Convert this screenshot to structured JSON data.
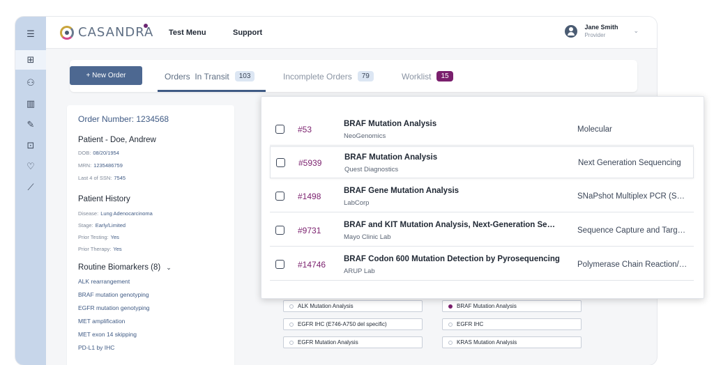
{
  "app": {
    "brand": "CASANDRA"
  },
  "topbar": {
    "nav": [
      "Test Menu",
      "Support"
    ],
    "user_name": "Jane Smith",
    "user_role": "Provider"
  },
  "toolbar": {
    "new_order_label": "+ New Order"
  },
  "tabs": [
    {
      "label": "Orders  In Transit",
      "count": "103"
    },
    {
      "label": "Incomplete Orders",
      "count": "79"
    },
    {
      "label": "Worklist",
      "count": "15"
    }
  ],
  "order": {
    "number": "Order Number: 1234568",
    "patient_title": "Patient - Doe, Andrew",
    "dob_label": "DOB:",
    "dob": "08/20/1954",
    "mrn_label": "MRN:",
    "mrn": "1235486759",
    "ssn_label": "Last 4 of SSN:",
    "ssn": "7545",
    "history_title": "Patient History",
    "disease_label": "Disease:",
    "disease": "Lung Adenocarcinoma",
    "stage_label": "Stage:",
    "stage": "Early/Limited",
    "prior_testing_label": "Prior Testing:",
    "prior_testing": "Yes",
    "prior_therapy_label": "Prior Therapy:",
    "prior_therapy": "Yes",
    "biomarkers_title": "Routine Biomarkers (8)",
    "biomarkers": [
      "ALK rearrangement",
      "BRAF mutation genotyping",
      "EGFR mutation genotyping",
      "MET amplification",
      "MET exon 14 skipping",
      "PD-L1 by IHC"
    ]
  },
  "options": [
    {
      "label": "ALK Mutation Analysis",
      "selected": false
    },
    {
      "label": "BRAF Mutation Analysis",
      "selected": true
    },
    {
      "label": "EGFR IHC (E746-A750 del specific)",
      "selected": false
    },
    {
      "label": "EGFR IHC",
      "selected": false
    },
    {
      "label": "EGFR Mutation Analysis",
      "selected": false
    },
    {
      "label": "KRAS Mutation Analysis",
      "selected": false
    }
  ],
  "results": [
    {
      "id": "#53",
      "title": "BRAF Mutation Analysis",
      "lab": "NeoGenomics",
      "method": "Molecular"
    },
    {
      "id": "#5939",
      "title": "BRAF Mutation Analysis",
      "lab": "Quest Diagnostics",
      "method": "Next Generation Sequencing"
    },
    {
      "id": "#1498",
      "title": "BRAF Gene Mutation Analysis",
      "lab": "LabCorp",
      "method": "SNaPshot Multiplex PCR (Sequencing)"
    },
    {
      "id": "#9731",
      "title": "BRAF and KIT Mutation Analysis, Next-Generation Sequencing",
      "lab": "Mayo Clinic Lab",
      "method": "Sequence Capture and Targeted Sequencing"
    },
    {
      "id": "#14746",
      "title": "BRAF Codon 600 Mutation Detection by Pyrosequencing",
      "lab": "ARUP Lab",
      "method": "Polymerase Chain Reaction/Pyrosequencing"
    }
  ],
  "colors": {
    "accent": "#3f5a84",
    "brand_purple": "#7a1f6d",
    "rail": "#c7d6ea"
  },
  "icons": {
    "rail": [
      "menu-icon",
      "add-order-icon",
      "users-icon",
      "report-icon",
      "test-tube-icon",
      "box-icon",
      "heart-icon",
      "trend-chart-icon"
    ]
  }
}
